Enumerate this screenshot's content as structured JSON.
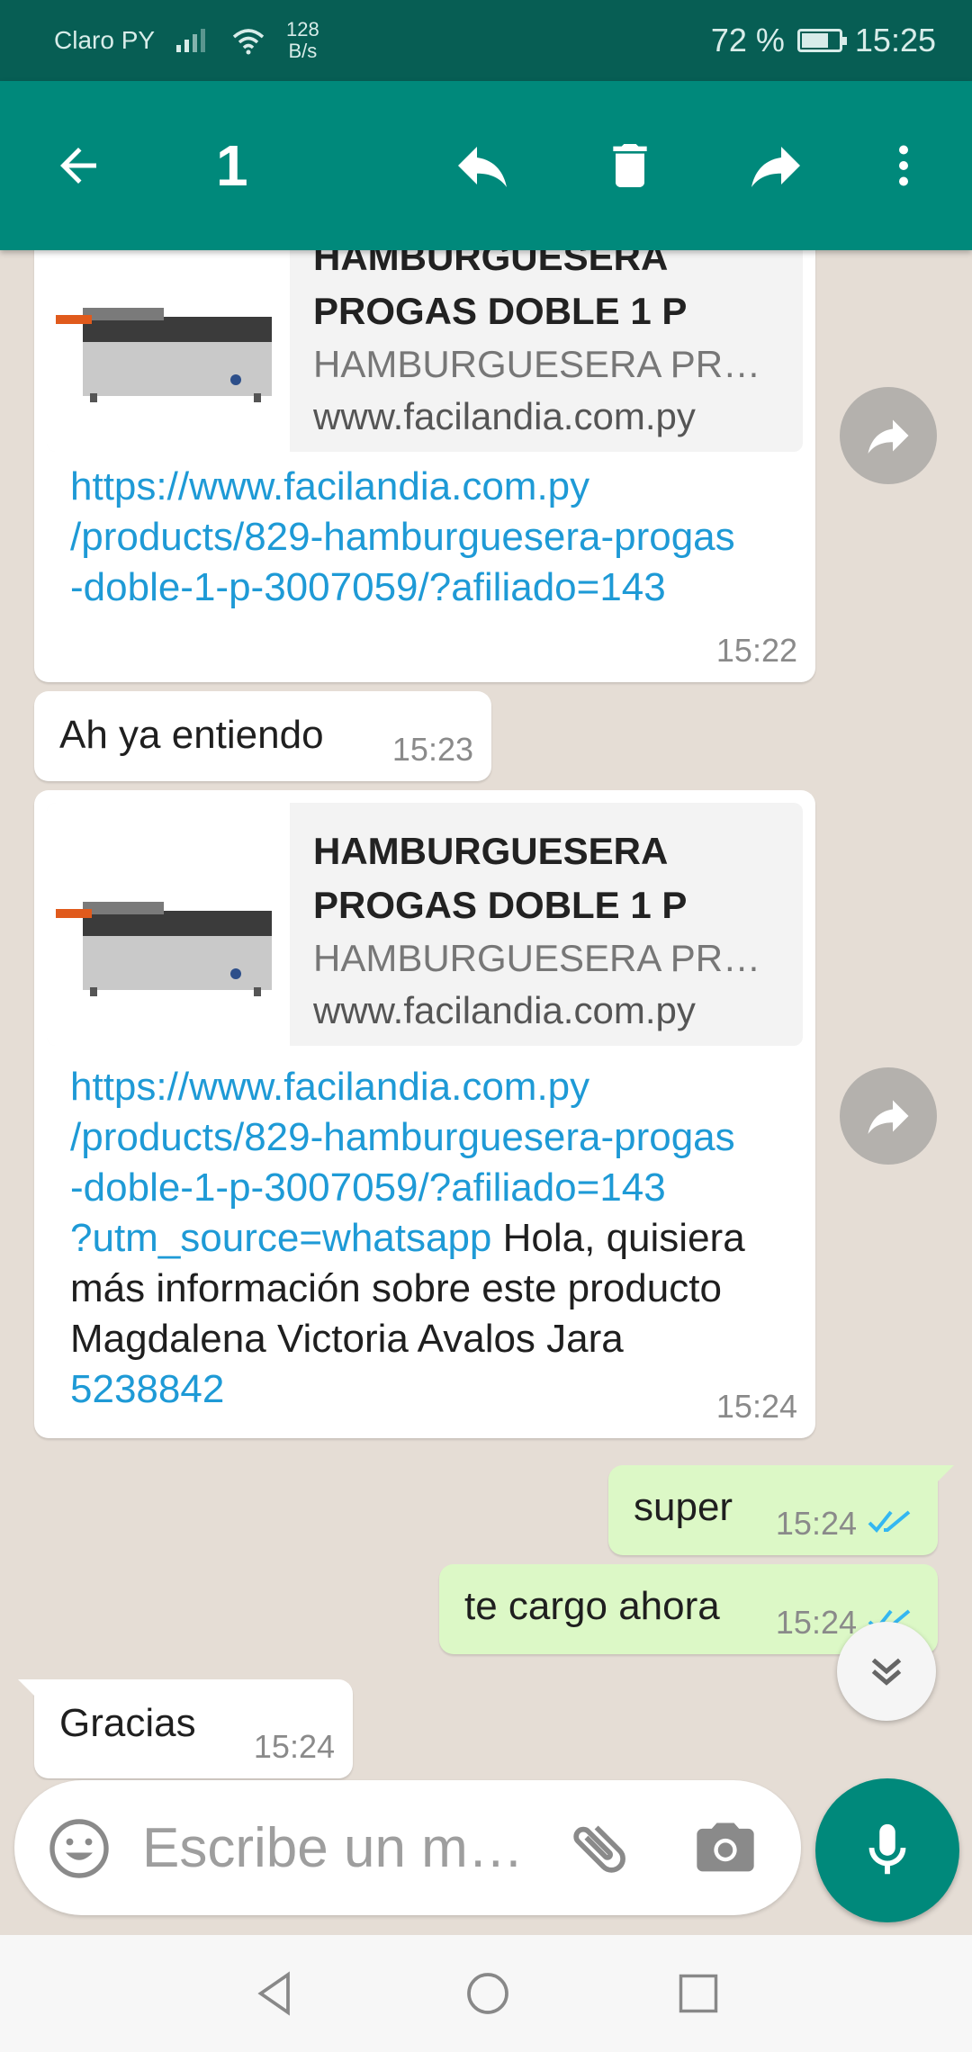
{
  "status_bar": {
    "carrier": "Claro PY",
    "net_speed_value": "128",
    "net_speed_unit": "B/s",
    "battery": "72 %",
    "battery_level": 0.72,
    "time": "15:25"
  },
  "action_bar": {
    "selected_count": "1",
    "icons": [
      "back-arrow-icon",
      "reply-icon",
      "delete-icon",
      "forward-icon",
      "more-vert-icon"
    ]
  },
  "messages": [
    {
      "direction": "incoming",
      "preview_title_partial": "HAMBURGUESERA",
      "preview_title_line2": "PROGAS DOBLE 1 P",
      "preview_desc": "HAMBURGUESERA PR…",
      "preview_site": "www.facilandia.com.py",
      "link_lines": [
        "https://www.facilandia.com.py",
        "/products/829-hamburguesera-progas",
        "-doble-1-p-3007059/?afiliado=143"
      ],
      "time": "15:22"
    },
    {
      "direction": "incoming",
      "text": "Ah ya entiendo",
      "time": "15:23"
    },
    {
      "direction": "incoming",
      "preview_title": "HAMBURGUESERA",
      "preview_title_line2": "PROGAS DOBLE 1 P",
      "preview_desc": "HAMBURGUESERA PR…",
      "preview_site": "www.facilandia.com.py",
      "link_lines": [
        "https://www.facilandia.com.py",
        "/products/829-hamburguesera-progas",
        "-doble-1-p-3007059/?afiliado=143",
        "?utm_source=whatsapp"
      ],
      "text_after_link": " Hola, quisiera",
      "text_lines": [
        "más información sobre este producto",
        "Magdalena Victoria Avalos Jara"
      ],
      "phone_link": "5238842",
      "time": "15:24"
    },
    {
      "direction": "outgoing",
      "text": "super",
      "time": "15:24",
      "status": "read"
    },
    {
      "direction": "outgoing",
      "text": "te cargo ahora",
      "time": "15:24",
      "status": "read"
    },
    {
      "direction": "incoming",
      "text": "Gracias",
      "time": "15:24"
    }
  ],
  "input": {
    "placeholder": "Escribe un m…"
  },
  "colors": {
    "status_bar": "#075e54",
    "action_bar": "#00897b",
    "chat_bg": "#e5ddd5",
    "incoming": "#ffffff",
    "outgoing": "#dcf8c6",
    "link": "#1e9ad6",
    "read_ticks": "#34b7f1"
  }
}
